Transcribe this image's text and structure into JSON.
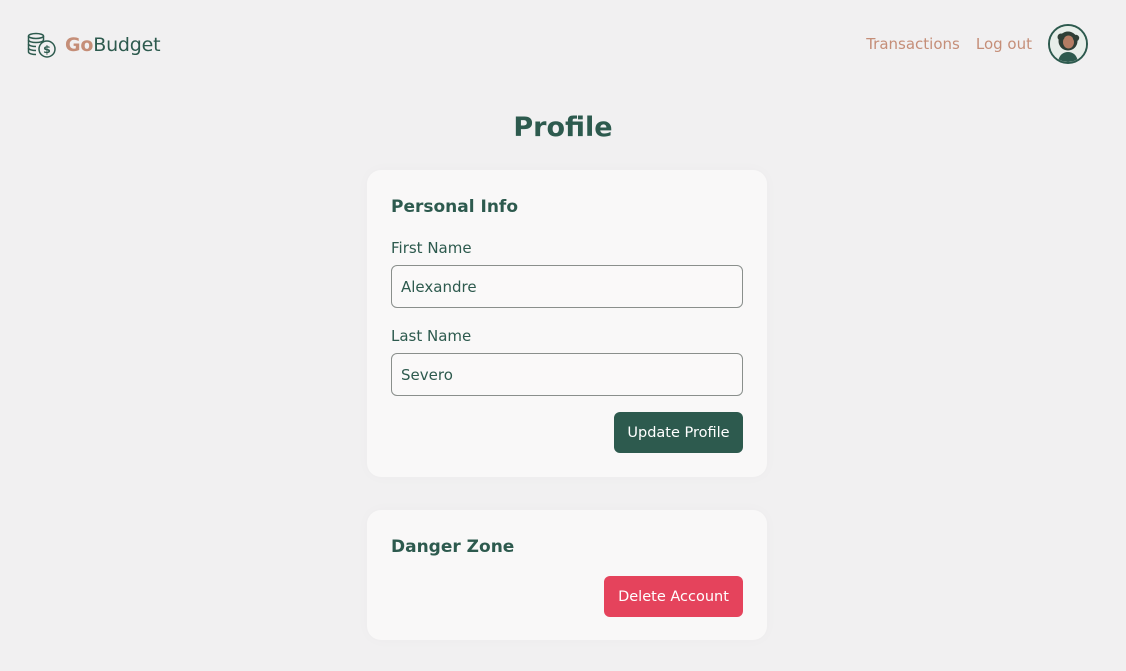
{
  "app": {
    "brand_prefix": "Go",
    "brand_suffix": "Budget",
    "brand_icon": "coins-icon"
  },
  "nav": {
    "transactions_label": "Transactions",
    "logout_label": "Log out",
    "avatar_icon": "user-avatar"
  },
  "page": {
    "title": "Profile"
  },
  "personal_info": {
    "title": "Personal Info",
    "first_name_label": "First Name",
    "first_name_value": "Alexandre",
    "last_name_label": "Last Name",
    "last_name_value": "Severo",
    "update_button_label": "Update Profile"
  },
  "danger_zone": {
    "title": "Danger Zone",
    "delete_button_label": "Delete Account"
  },
  "colors": {
    "primary": "#2d5a4e",
    "accent": "#c58e78",
    "danger": "#e5435c",
    "background": "#f1f0f1",
    "card": "#f9f8f8"
  }
}
